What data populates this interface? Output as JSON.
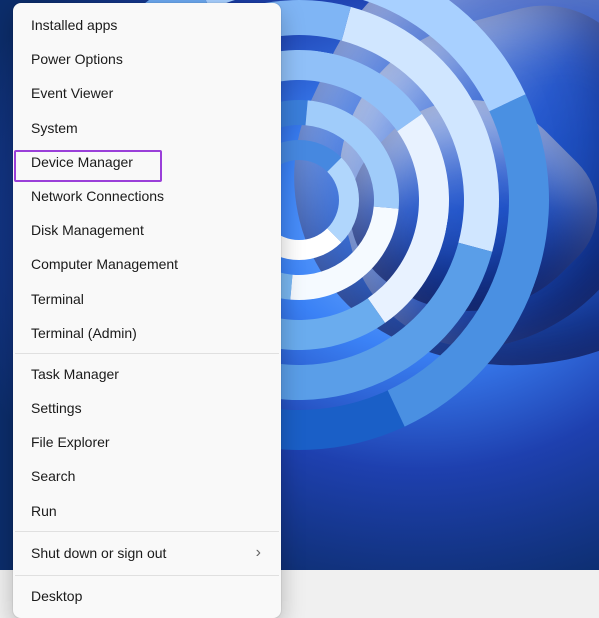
{
  "menu": {
    "groups": [
      [
        {
          "key": "installed-apps",
          "label": "Installed apps",
          "submenu": false
        },
        {
          "key": "power-options",
          "label": "Power Options",
          "submenu": false
        },
        {
          "key": "event-viewer",
          "label": "Event Viewer",
          "submenu": false
        },
        {
          "key": "system",
          "label": "System",
          "submenu": false
        },
        {
          "key": "device-manager",
          "label": "Device Manager",
          "submenu": false,
          "highlighted": true
        },
        {
          "key": "network-connections",
          "label": "Network Connections",
          "submenu": false
        },
        {
          "key": "disk-management",
          "label": "Disk Management",
          "submenu": false
        },
        {
          "key": "computer-management",
          "label": "Computer Management",
          "submenu": false
        },
        {
          "key": "terminal",
          "label": "Terminal",
          "submenu": false
        },
        {
          "key": "terminal-admin",
          "label": "Terminal (Admin)",
          "submenu": false
        }
      ],
      [
        {
          "key": "task-manager",
          "label": "Task Manager",
          "submenu": false
        },
        {
          "key": "settings",
          "label": "Settings",
          "submenu": false
        },
        {
          "key": "file-explorer",
          "label": "File Explorer",
          "submenu": false
        },
        {
          "key": "search",
          "label": "Search",
          "submenu": false
        },
        {
          "key": "run",
          "label": "Run",
          "submenu": false
        }
      ],
      [
        {
          "key": "shut-down",
          "label": "Shut down or sign out",
          "submenu": true
        }
      ],
      [
        {
          "key": "desktop",
          "label": "Desktop",
          "submenu": false
        }
      ]
    ]
  },
  "highlight_color": "#9a3fd9"
}
